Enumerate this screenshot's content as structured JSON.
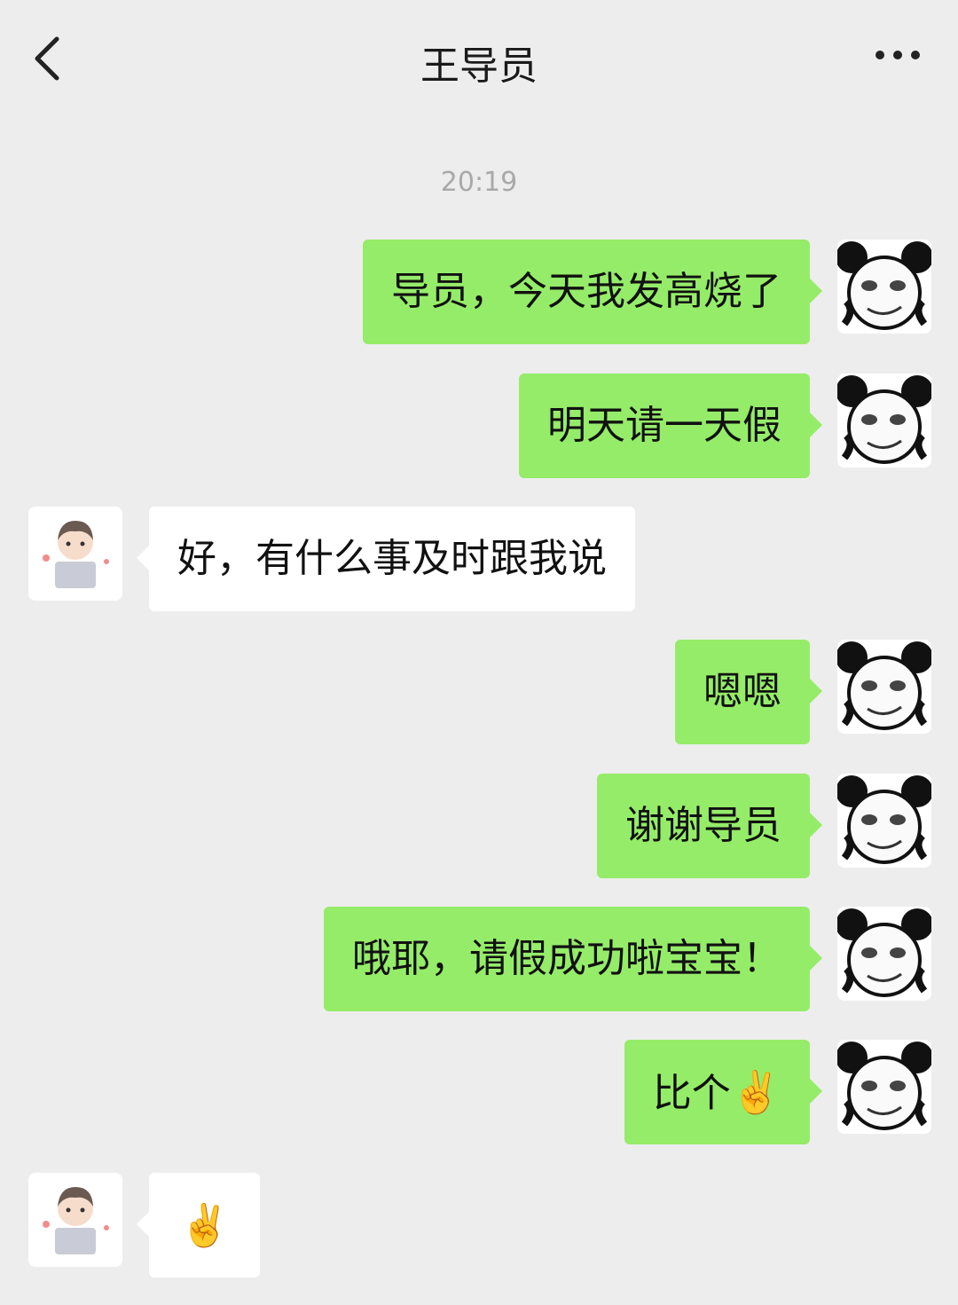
{
  "header": {
    "title": "王导员",
    "back_icon": "back-chevron-icon",
    "more_icon": "more-dots-icon"
  },
  "chat": {
    "timestamp": "20:19",
    "messages": [
      {
        "from": "me",
        "text": "导员，今天我发高烧了"
      },
      {
        "from": "me",
        "text": "明天请一天假"
      },
      {
        "from": "them",
        "text": "好，有什么事及时跟我说"
      },
      {
        "from": "me",
        "text": "嗯嗯"
      },
      {
        "from": "me",
        "text": "谢谢导员"
      },
      {
        "from": "me",
        "text": "哦耶，请假成功啦宝宝！"
      },
      {
        "from": "me",
        "text": "比个",
        "emoji": "✌️"
      },
      {
        "from": "them",
        "text": "",
        "emoji": "✌️"
      }
    ]
  },
  "colors": {
    "background": "#ededed",
    "my_bubble": "#95ec69",
    "their_bubble": "#ffffff",
    "timestamp": "#a9a9a9"
  }
}
